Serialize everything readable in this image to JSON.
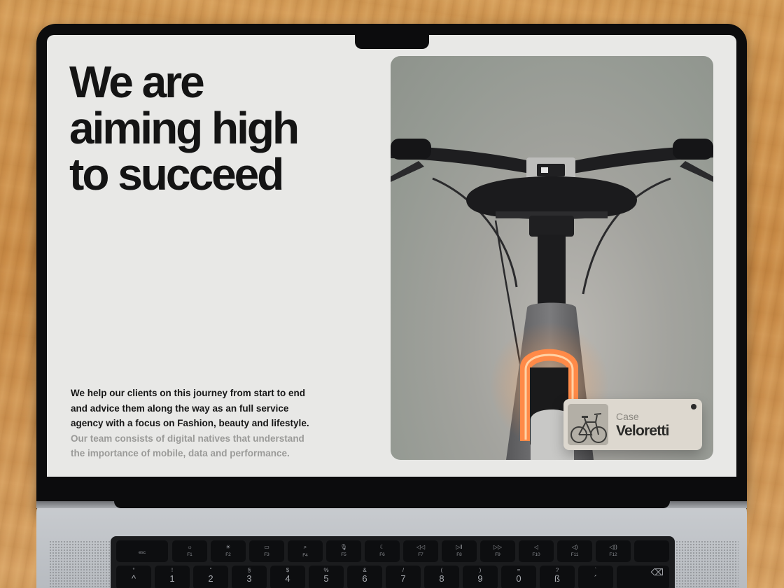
{
  "headline": {
    "line1": "We are",
    "line2": "aiming high",
    "line3": "to succeed"
  },
  "body": {
    "primary": "We help our clients on this journey from start to end and advice them along the way as an full service agency with a focus on Fashion, beauty and lifestyle.",
    "secondary": "Our team consists of digital natives that understand the importance of mobile, data and performance."
  },
  "case_card": {
    "label": "Case",
    "title": "Veloretti"
  },
  "keyboard": {
    "fn_row": [
      {
        "glyph": "",
        "label": "esc"
      },
      {
        "glyph": "☼",
        "label": "F1"
      },
      {
        "glyph": "☀",
        "label": "F2"
      },
      {
        "glyph": "▭",
        "label": "F3"
      },
      {
        "glyph": "⌕",
        "label": "F4"
      },
      {
        "glyph": "🎙",
        "label": "F5"
      },
      {
        "glyph": "☾",
        "label": "F6"
      },
      {
        "glyph": "◁◁",
        "label": "F7"
      },
      {
        "glyph": "▷‖",
        "label": "F8"
      },
      {
        "glyph": "▷▷",
        "label": "F9"
      },
      {
        "glyph": "◁",
        "label": "F10"
      },
      {
        "glyph": "◁)",
        "label": "F11"
      },
      {
        "glyph": "◁))",
        "label": "F12"
      },
      {
        "glyph": "",
        "label": ""
      }
    ],
    "num_row": [
      {
        "top": "°",
        "main": "^"
      },
      {
        "top": "!",
        "main": "1"
      },
      {
        "top": "\"",
        "main": "2"
      },
      {
        "top": "§",
        "main": "3"
      },
      {
        "top": "$",
        "main": "4"
      },
      {
        "top": "%",
        "main": "5"
      },
      {
        "top": "&",
        "main": "6"
      },
      {
        "top": "/",
        "main": "7"
      },
      {
        "top": "(",
        "main": "8"
      },
      {
        "top": ")",
        "main": "9"
      },
      {
        "top": "=",
        "main": "0"
      },
      {
        "top": "?",
        "main": "ß"
      },
      {
        "top": "`",
        "main": "´"
      },
      {
        "top": "",
        "main": "⌫"
      }
    ]
  }
}
